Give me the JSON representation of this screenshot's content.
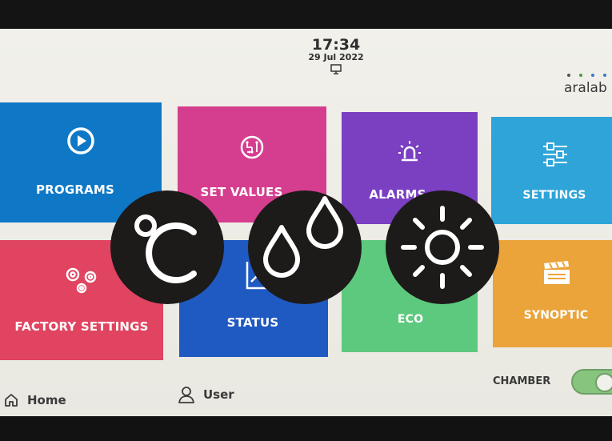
{
  "header": {
    "time": "17:34",
    "date": "29 Jul 2022"
  },
  "brand": {
    "name": "aralab",
    "dot_colors": [
      "#555555",
      "#4a9c4a",
      "#3b7ac7",
      "#3b7ac7"
    ]
  },
  "tiles": [
    {
      "label": "PROGRAMS",
      "icon": "play-icon",
      "color": "#0f78c6"
    },
    {
      "label": "SET VALUES",
      "icon": "circuit-icon",
      "color": "#d53e8f"
    },
    {
      "label": "ALARMS",
      "icon": "alarm-beacon-icon",
      "color": "#7b3fc2"
    },
    {
      "label": "SETTINGS",
      "icon": "sliders-icon",
      "color": "#2ea4d9"
    },
    {
      "label": "FACTORY SETTINGS",
      "icon": "gears-icon",
      "color": "#e04460"
    },
    {
      "label": "STATUS",
      "icon": "chart-icon",
      "color": "#1f59c2"
    },
    {
      "label": "ECO",
      "icon": "leaf-icon",
      "color": "#5dc97e"
    },
    {
      "label": "SYNOPTIC",
      "icon": "clapperboard-icon",
      "color": "#eba43a"
    }
  ],
  "overlay_badges": [
    {
      "icon": "celsius-icon"
    },
    {
      "icon": "humidity-drops-icon"
    },
    {
      "icon": "light-sun-icon"
    }
  ],
  "footer": {
    "home_label": "Home",
    "user_label": "User",
    "chamber_label": "CHAMBER",
    "chamber_on": true
  }
}
